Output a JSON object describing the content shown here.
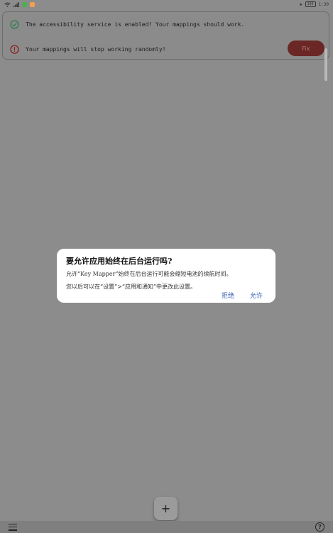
{
  "statusbar": {
    "left_icons": [
      "wifi-icon",
      "signal-icon",
      "app-notification-icon",
      "app-notification-icon"
    ],
    "time": "1:30",
    "battery": "100"
  },
  "status_card": {
    "row1_text": "The accessibility service is enabled! Your mappings should work.",
    "row2_text": "Your mappings will stop working randomly!",
    "fix_label": "Fix"
  },
  "dialog": {
    "title": "要允许应用始终在后台运行吗?",
    "message": "允许“Key Mapper”始终在后台运行可能会缩短电池的续航时间。",
    "message2": "您以后可以在“设置”>“应用和通知”中更改此设置。",
    "deny_label": "拒绝",
    "allow_label": "允许"
  },
  "fab": {
    "label": "+"
  },
  "bottombar": {
    "help_label": "?"
  },
  "colors": {
    "success": "#2e7d4f",
    "error": "#8b1e1e",
    "dialog_action": "#3a5fb5"
  }
}
